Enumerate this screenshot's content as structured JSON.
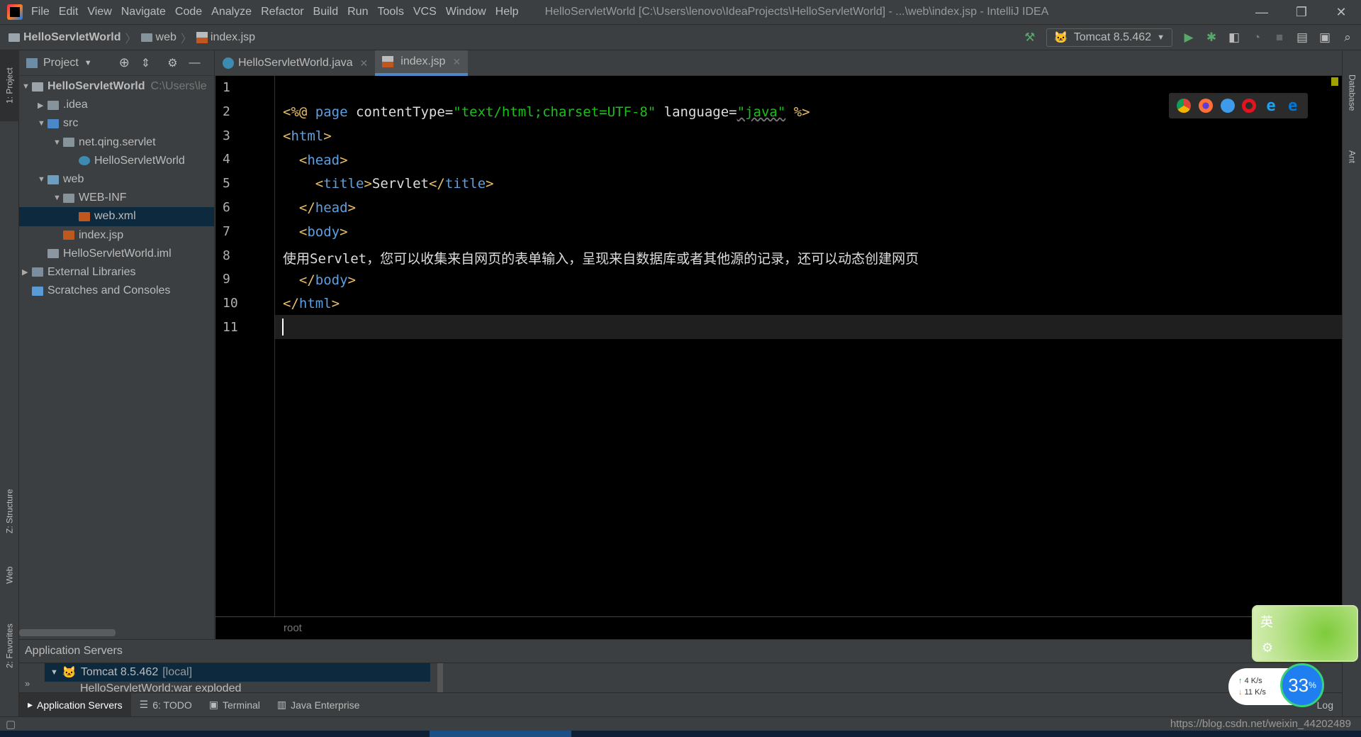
{
  "menu": [
    "File",
    "Edit",
    "View",
    "Navigate",
    "Code",
    "Analyze",
    "Refactor",
    "Build",
    "Run",
    "Tools",
    "VCS",
    "Window",
    "Help"
  ],
  "window_title": "HelloServletWorld [C:\\Users\\lenovo\\IdeaProjects\\HelloServletWorld] - ...\\web\\index.jsp - IntelliJ IDEA",
  "breadcrumb": [
    "HelloServletWorld",
    "web",
    "index.jsp"
  ],
  "run_config": "Tomcat 8.5.462",
  "project_panel": {
    "title": "Project",
    "tree": [
      {
        "label": "HelloServletWorld",
        "hint": "C:\\Users\\le",
        "depth": 0,
        "arrow": "▼",
        "type": "module"
      },
      {
        "label": ".idea",
        "depth": 1,
        "arrow": "▶",
        "type": "folder"
      },
      {
        "label": "src",
        "depth": 1,
        "arrow": "▼",
        "type": "src"
      },
      {
        "label": "net.qing.servlet",
        "depth": 2,
        "arrow": "▼",
        "type": "package"
      },
      {
        "label": "HelloServletWorld",
        "depth": 3,
        "arrow": "",
        "type": "class"
      },
      {
        "label": "web",
        "depth": 1,
        "arrow": "▼",
        "type": "web"
      },
      {
        "label": "WEB-INF",
        "depth": 2,
        "arrow": "▼",
        "type": "folder"
      },
      {
        "label": "web.xml",
        "depth": 3,
        "arrow": "",
        "type": "xml",
        "selected": true
      },
      {
        "label": "index.jsp",
        "depth": 2,
        "arrow": "",
        "type": "jsp"
      },
      {
        "label": "HelloServletWorld.iml",
        "depth": 1,
        "arrow": "",
        "type": "iml"
      },
      {
        "label": "External Libraries",
        "depth": 0,
        "arrow": "▶",
        "type": "lib"
      },
      {
        "label": "Scratches and Consoles",
        "depth": 0,
        "arrow": "",
        "type": "scratch"
      }
    ]
  },
  "tabs": [
    {
      "label": "HelloServletWorld.java",
      "active": false
    },
    {
      "label": "index.jsp",
      "active": true
    }
  ],
  "editor": {
    "line_numbers": [
      "1",
      "2",
      "3",
      "4",
      "5",
      "6",
      "7",
      "8",
      "9",
      "10",
      "11"
    ],
    "current_line": 11,
    "breadcrumb": "root"
  },
  "left_stripe": [
    "1: Project",
    "Z: Structure",
    "Web",
    "2: Favorites"
  ],
  "right_stripe": [
    "Database",
    "Ant"
  ],
  "app_servers": {
    "title": "Application Servers",
    "server": "Tomcat 8.5.462",
    "server_suffix": "[local]",
    "artifact": "HelloServletWorld:war exploded"
  },
  "bottom_tabs": [
    "Application Servers",
    "6: TODO",
    "Terminal",
    "Java Enterprise"
  ],
  "status_right": "https://blog.csdn.net/weixin_44202489",
  "event_log": "Log",
  "overlay": {
    "ime": "英",
    "up": "4 K/s",
    "down": "11 K/s",
    "percent": "33",
    "percent_sign": "%"
  },
  "colors": {
    "accent": "#4a88c7",
    "editor_bg": "#000000",
    "tag": "#e8bf6a",
    "string": "#1bbf1b"
  }
}
